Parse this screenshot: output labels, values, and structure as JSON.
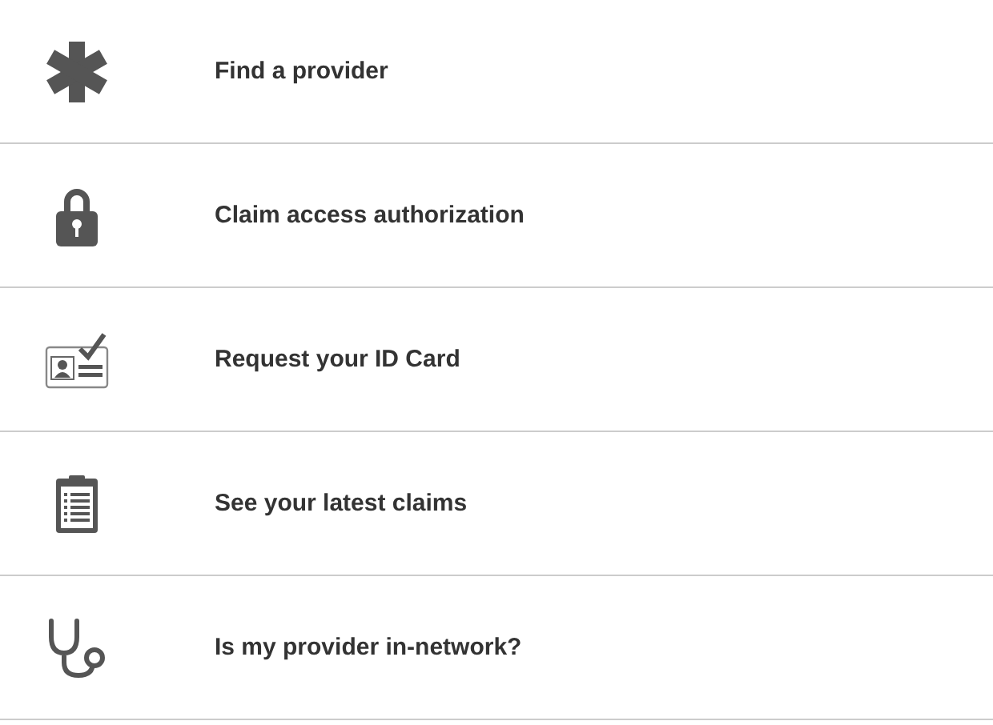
{
  "menu": [
    {
      "kind": "asterisk",
      "label": "Find a provider"
    },
    {
      "kind": "lock",
      "label": "Claim access authorization"
    },
    {
      "kind": "idcard",
      "label": "Request your ID Card"
    },
    {
      "kind": "clipboard",
      "label": "See your latest claims"
    },
    {
      "kind": "stethoscope",
      "label": "Is my provider in-network?"
    }
  ]
}
